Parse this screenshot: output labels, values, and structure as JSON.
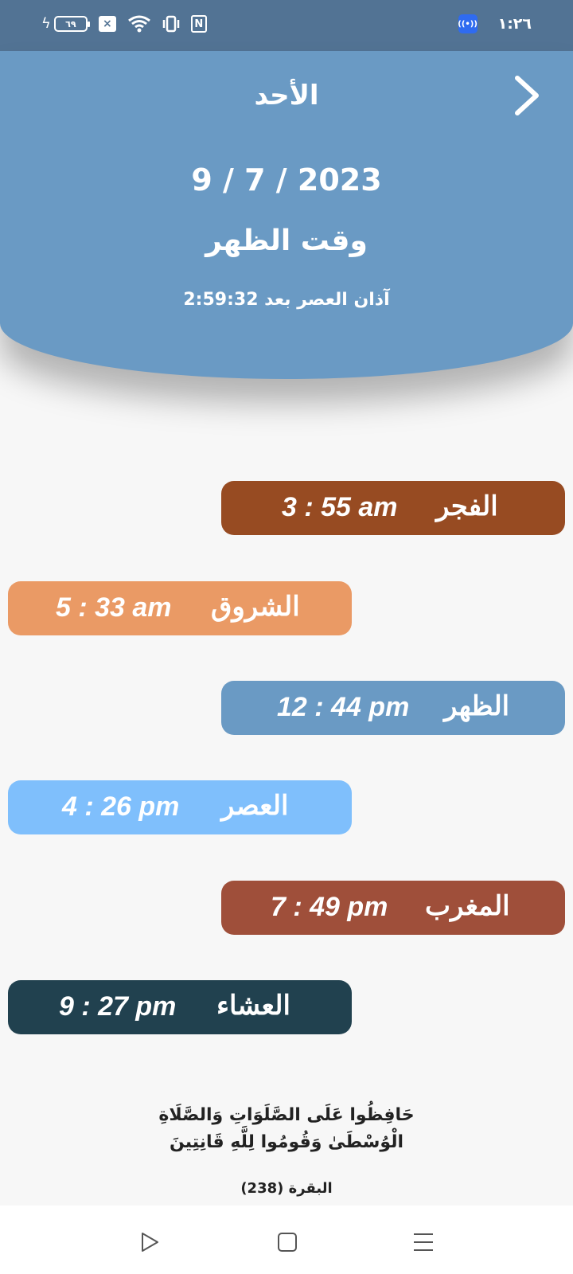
{
  "status_bar": {
    "battery_level": "٦٩",
    "clock": "١:٢٦",
    "icons": [
      "charging-icon",
      "battery-icon",
      "notification-x-icon",
      "wifi-icon",
      "vibrate-icon",
      "nfc-icon",
      "hotspot-icon"
    ]
  },
  "header": {
    "day": "الأحد",
    "date": "9 / 7 / 2023",
    "current_prayer": "وقت الظهر",
    "next_prayer_countdown": "آذان العصر بعد 2:59:32"
  },
  "prayers": [
    {
      "name": "الفجر",
      "time": "3 : 55 am",
      "color": "#974b22"
    },
    {
      "name": "الشروق",
      "time": "5 : 33 am",
      "color": "#ea9a65"
    },
    {
      "name": "الظهر",
      "time": "12 : 44 pm",
      "color": "#6a9ac4"
    },
    {
      "name": "العصر",
      "time": "4 : 26 pm",
      "color": "#7fbffc"
    },
    {
      "name": "المغرب",
      "time": "7 : 49 pm",
      "color": "#9f4f3a"
    },
    {
      "name": "العشاء",
      "time": "9 : 27 pm",
      "color": "#21414f"
    }
  ],
  "verse": {
    "line1": "حَافِظُوا عَلَى الصَّلَوَاتِ وَالصَّلَاةِ",
    "line2": "الْوُسْطَىٰ وَقُومُوا لِلَّهِ قَانِتِينَ",
    "reference": "البقرة (238)"
  },
  "colors": {
    "status_bar": "#527394",
    "header": "#6a9ac4",
    "background": "#f7f7f7"
  },
  "nav_bar": {
    "icons": [
      "back-icon",
      "home-icon",
      "recents-icon"
    ]
  }
}
